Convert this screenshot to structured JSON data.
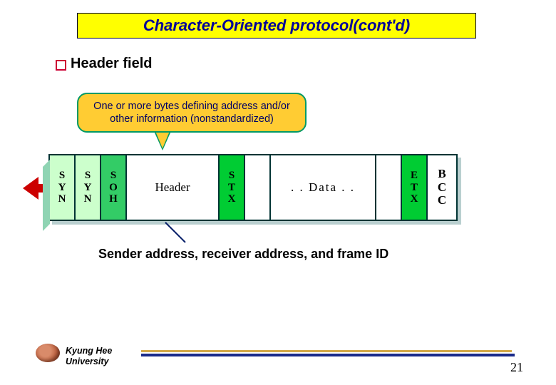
{
  "title": "Character-Oriented protocol(cont'd)",
  "bullet": "Header field",
  "callout": "One or more bytes defining address and/or other information (nonstandardized)",
  "frame": {
    "syn": "S\nY\nN",
    "soh": "S\nO\nH",
    "header": "Header",
    "stx": "S\nT\nX",
    "data": ". .  Data . .",
    "etx": "E\nT\nX",
    "bcc": "B\nC\nC"
  },
  "caption": "Sender address, receiver address, and frame ID",
  "footer": {
    "uni1": "Kyung Hee",
    "uni2": "University"
  },
  "page": "21"
}
